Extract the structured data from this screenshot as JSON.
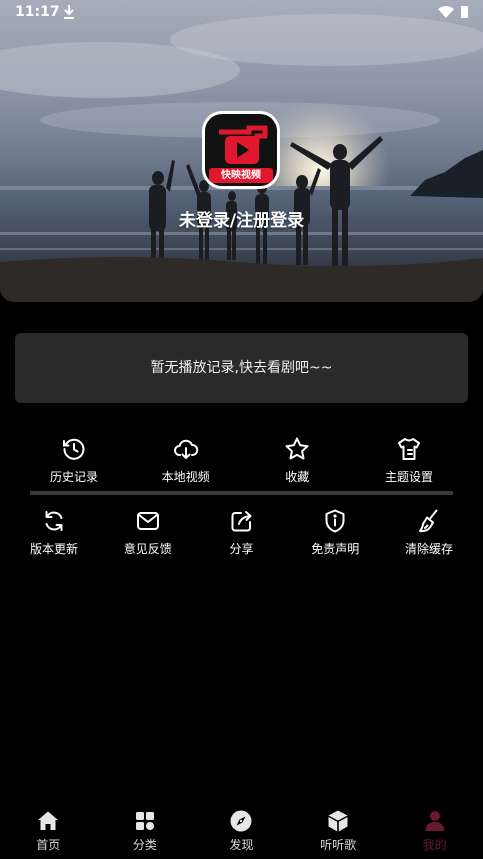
{
  "status_bar": {
    "time": "11:17"
  },
  "profile": {
    "app_logo_text": "快映视频",
    "login_prompt": "未登录/注册登录"
  },
  "history": {
    "empty_text": "暂无播放记录,快去看剧吧~~"
  },
  "shortcuts_row1": [
    {
      "label": "历史记录",
      "icon": "history-icon"
    },
    {
      "label": "本地视频",
      "icon": "cloud-download-icon"
    },
    {
      "label": "收藏",
      "icon": "star-icon"
    },
    {
      "label": "主题设置",
      "icon": "shirt-icon"
    }
  ],
  "shortcuts_row2": [
    {
      "label": "版本更新",
      "icon": "refresh-icon"
    },
    {
      "label": "意见反馈",
      "icon": "mail-icon"
    },
    {
      "label": "分享",
      "icon": "share-icon"
    },
    {
      "label": "免责声明",
      "icon": "shield-info-icon"
    },
    {
      "label": "清除缓存",
      "icon": "broom-icon"
    }
  ],
  "bottom_nav": [
    {
      "label": "首页",
      "icon": "home-icon"
    },
    {
      "label": "分类",
      "icon": "category-icon"
    },
    {
      "label": "发现",
      "icon": "compass-icon"
    },
    {
      "label": "听听歌",
      "icon": "cube-icon"
    },
    {
      "label": "我的",
      "icon": "user-icon",
      "active": true
    }
  ],
  "colors": {
    "accent": "#6a1830",
    "card_bg": "#2a2a2a",
    "logo_red": "#e0182d"
  }
}
